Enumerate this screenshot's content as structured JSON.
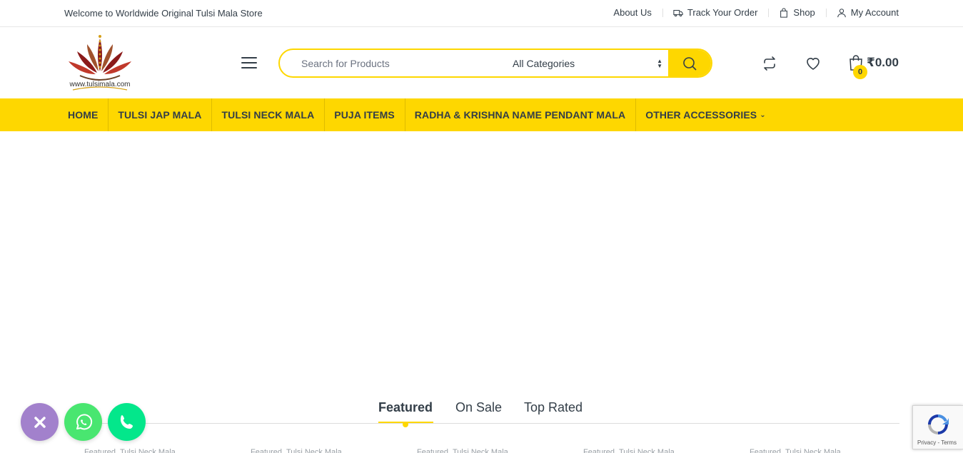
{
  "topbar": {
    "welcome": "Welcome to Worldwide Original Tulsi Mala Store",
    "links": [
      {
        "label": "About Us",
        "icon": null
      },
      {
        "label": "Track Your Order",
        "icon": "truck-icon"
      },
      {
        "label": "Shop",
        "icon": "shopping-bag-icon"
      },
      {
        "label": "My Account",
        "icon": "user-icon"
      }
    ]
  },
  "logo": {
    "text": "www.tulsimala.com"
  },
  "search": {
    "placeholder": "Search for Products",
    "category": "All Categories"
  },
  "cart": {
    "count": "0",
    "amount": "₹0.00"
  },
  "nav": {
    "items": [
      {
        "label": "HOME"
      },
      {
        "label": "TULSI JAP MALA"
      },
      {
        "label": "TULSI NECK MALA"
      },
      {
        "label": "PUJA ITEMS"
      },
      {
        "label": "RADHA & KRISHNA NAME PENDANT MALA"
      },
      {
        "label": "OTHER ACCESSORIES"
      }
    ]
  },
  "tabs": {
    "items": [
      {
        "label": "Featured",
        "active": true
      },
      {
        "label": "On Sale",
        "active": false
      },
      {
        "label": "Top Rated",
        "active": false
      }
    ]
  },
  "product_categories_partial": [
    "Featured, Tulsi Neck Mala",
    "Featured, Tulsi Neck Mala",
    "Featured, Tulsi Neck Mala",
    "Featured, Tulsi Neck Mala",
    "Featured, Tulsi Neck Mala"
  ],
  "recaptcha": {
    "terms": "Privacy - Terms"
  },
  "colors": {
    "accent": "#fed700",
    "text": "#333e48",
    "whatsapp": "#49e670",
    "phone": "#03e78b",
    "close": "#a281cc"
  }
}
